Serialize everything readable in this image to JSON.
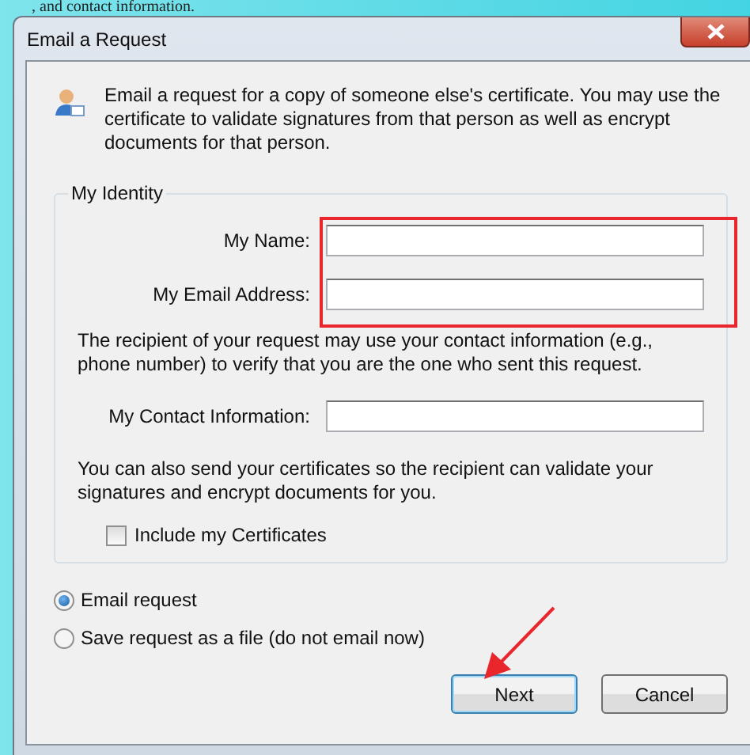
{
  "background_text": ", and contact information.",
  "window": {
    "title": "Email a Request"
  },
  "intro": "Email a request for a copy of someone else's certificate. You may use the certificate to validate signatures from that person as well as encrypt documents for that person.",
  "identity": {
    "legend": "My Identity",
    "fields": [
      {
        "label": "My Name:",
        "highlighted": true
      },
      {
        "label": "My Email Address:",
        "highlighted": true
      }
    ],
    "contact_note": "The recipient of your request may use your contact information (e.g., phone number) to verify that you are the one who sent this request.",
    "contact_field": {
      "label": "My Contact Information:"
    },
    "certificate_note": "You can also send your certificates so the recipient can validate your signatures and encrypt documents for you.",
    "include_certificates": {
      "label": "Include my Certificates",
      "checked": false
    }
  },
  "delivery": [
    {
      "label": "Email request",
      "selected": true
    },
    {
      "label": "Save request as a file (do not email now)",
      "selected": false
    }
  ],
  "buttons": [
    {
      "label": "Next",
      "default": true,
      "pointed_at": true
    },
    {
      "label": "Cancel",
      "default": false,
      "pointed_at": false
    }
  ]
}
